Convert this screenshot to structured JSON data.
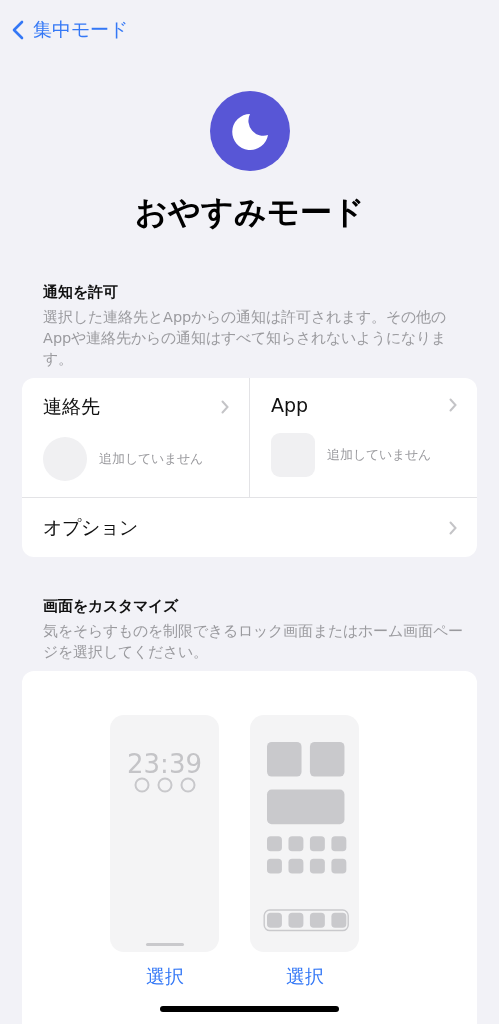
{
  "nav": {
    "back": "集中モード"
  },
  "focus": {
    "title": "おやすみモード"
  },
  "allow_notifications": {
    "header": "通知を許可",
    "description": "選択した連絡先とAppからの通知は許可されます。その他のAppや連絡先からの通知はすべて知らされないようになります。",
    "people": {
      "label": "連絡先",
      "status": "追加していません"
    },
    "apps": {
      "label": "App",
      "status": "追加していません"
    },
    "options": {
      "label": "オプション"
    }
  },
  "customize": {
    "header": "画面をカスタマイズ",
    "description": "気をそらすものを制限できるロック画面またはホーム画面ページを選択してください。",
    "screens": [
      {
        "kind": "lock",
        "time": "23:39",
        "action": "選択"
      },
      {
        "kind": "home",
        "action": "選択"
      }
    ]
  }
}
